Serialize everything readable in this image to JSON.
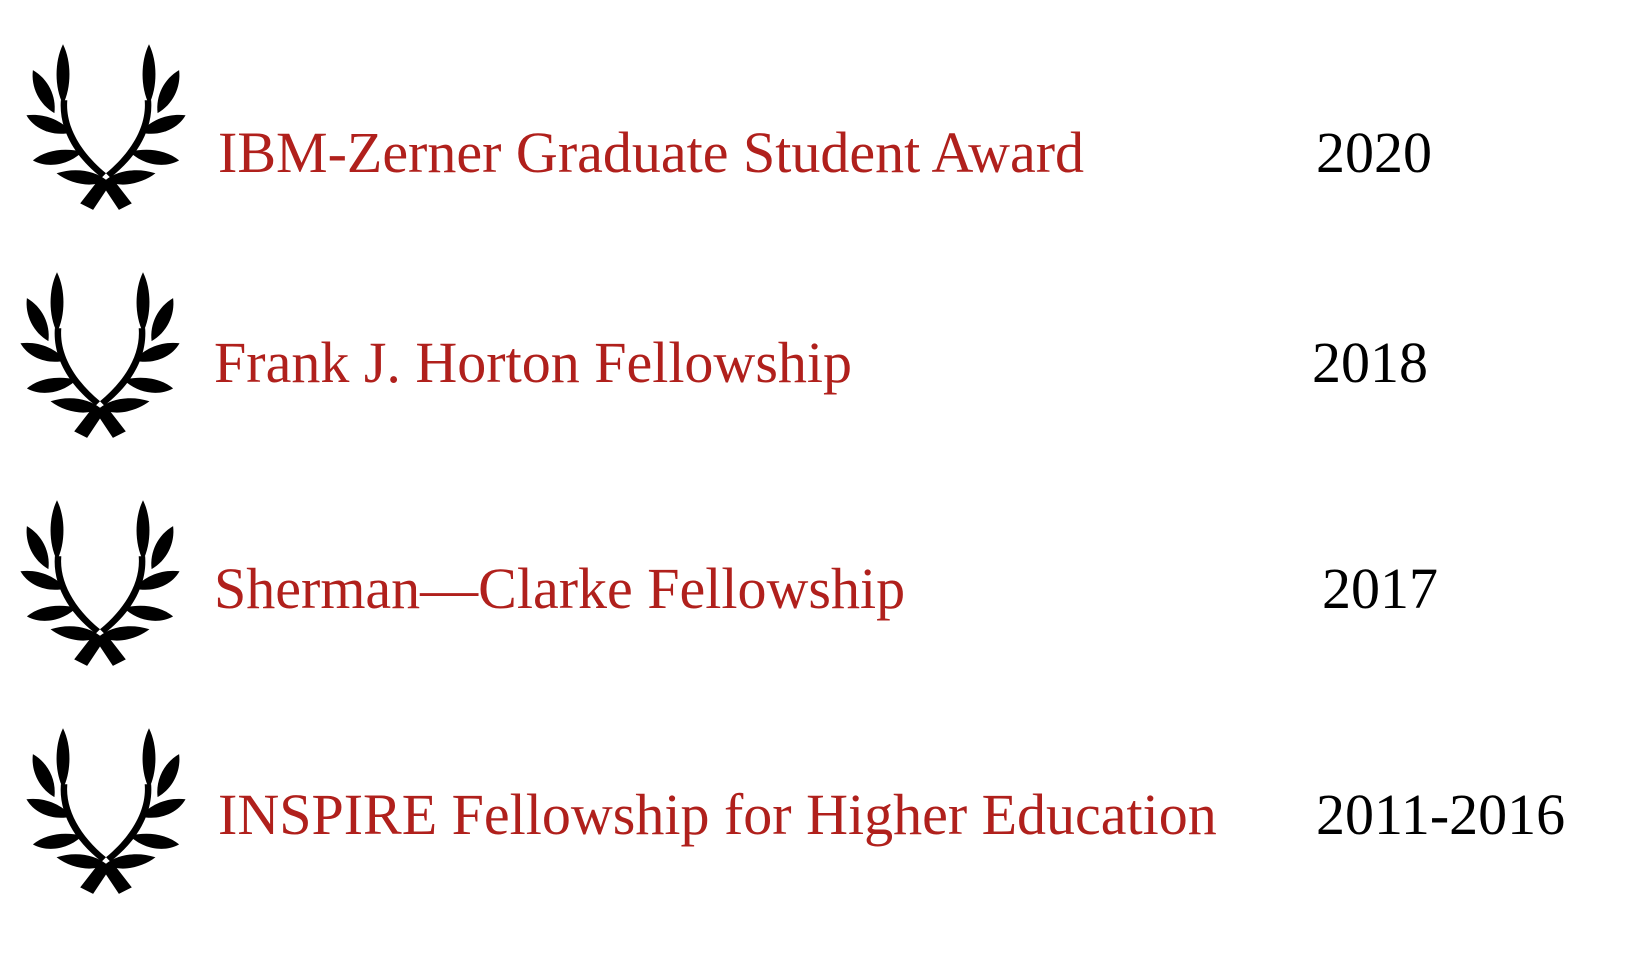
{
  "awards": [
    {
      "icon": "laurel-wreath-icon",
      "name": "IBM-Zerner Graduate Student Award",
      "year": "2020"
    },
    {
      "icon": "laurel-wreath-icon",
      "name": "Frank J. Horton Fellowship",
      "year": "2018"
    },
    {
      "icon": "laurel-wreath-icon",
      "name": "Sherman—Clarke Fellowship",
      "year": "2017"
    },
    {
      "icon": "laurel-wreath-icon",
      "name": "INSPIRE Fellowship for Higher Education",
      "year": "2011-2016"
    }
  ],
  "colors": {
    "award_name": "#b0201c",
    "year": "#000000",
    "icon": "#000000",
    "background": "#ffffff"
  }
}
